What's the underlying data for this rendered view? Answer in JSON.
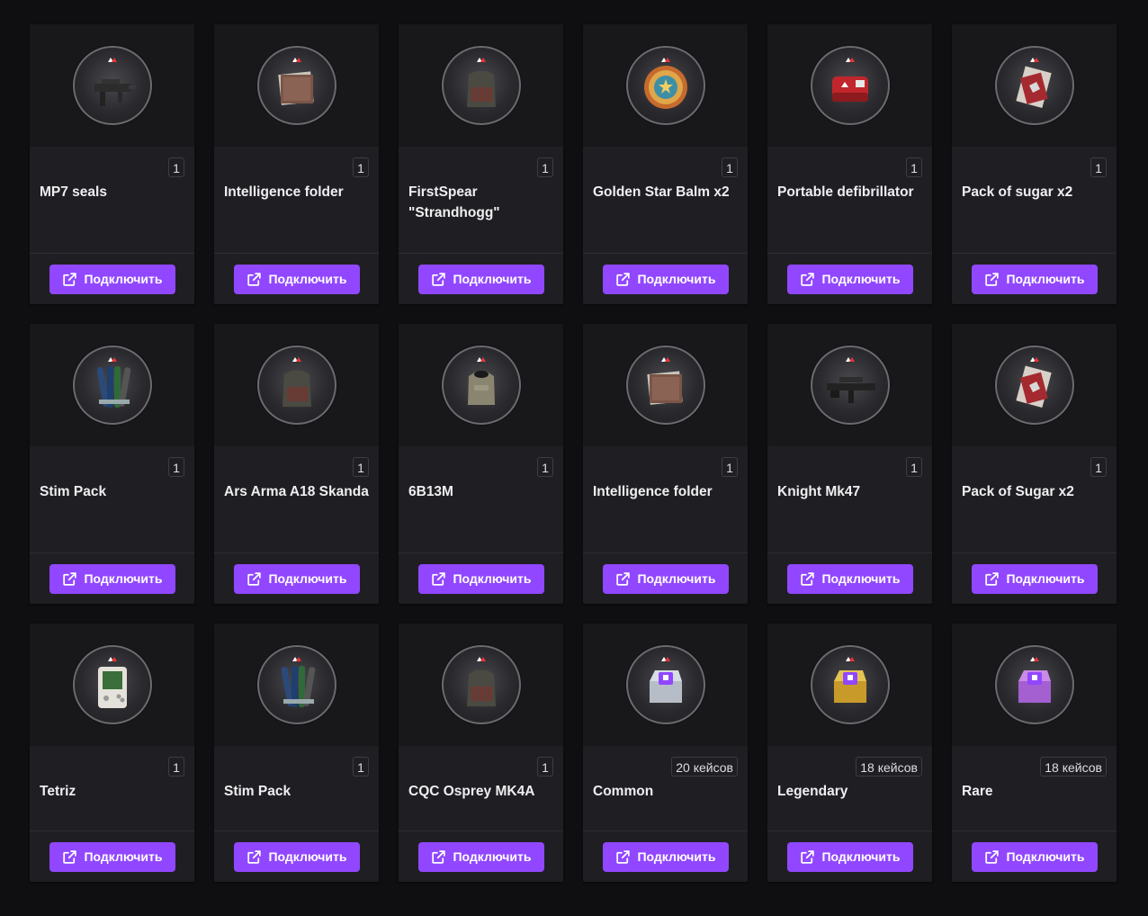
{
  "accent_color": "#9147ff",
  "button_icon": "external-link-icon",
  "rows": [
    [
      {
        "name": "MP7 seals",
        "count": "1",
        "icon": "smg-icon"
      },
      {
        "name": "Intelligence folder",
        "count": "1",
        "icon": "folder-icon"
      },
      {
        "name": "FirstSpear \"Strandhogg\"",
        "count": "1",
        "icon": "vest-icon"
      },
      {
        "name": "Golden Star Balm x2",
        "count": "1",
        "icon": "balm-tin-icon"
      },
      {
        "name": "Portable defibrillator",
        "count": "1",
        "icon": "defibrillator-icon"
      },
      {
        "name": "Pack of sugar x2",
        "count": "1",
        "icon": "sugar-pack-icon"
      }
    ],
    [
      {
        "name": "Stim Pack",
        "count": "1",
        "icon": "stim-icon"
      },
      {
        "name": "Ars Arma A18 Skanda",
        "count": "1",
        "icon": "vest-icon"
      },
      {
        "name": "6B13M",
        "count": "1",
        "icon": "armor-icon"
      },
      {
        "name": "Intelligence folder",
        "count": "1",
        "icon": "folder-icon"
      },
      {
        "name": "Knight Mk47",
        "count": "1",
        "icon": "rifle-icon"
      },
      {
        "name": "Pack of Sugar x2",
        "count": "1",
        "icon": "sugar-pack-icon"
      }
    ],
    [
      {
        "name": "Tetriz",
        "count": "1",
        "icon": "handheld-game-icon"
      },
      {
        "name": "Stim Pack",
        "count": "1",
        "icon": "stim-icon"
      },
      {
        "name": "CQC Osprey MK4A",
        "count": "1",
        "icon": "vest-icon"
      },
      {
        "name": "Common",
        "count": "20 кейсов",
        "icon": "silver-case-icon"
      },
      {
        "name": "Legendary",
        "count": "18 кейсов",
        "icon": "gold-case-icon"
      },
      {
        "name": "Rare",
        "count": "18 кейсов",
        "icon": "purple-case-icon"
      }
    ]
  ],
  "button_label": "Подключить"
}
